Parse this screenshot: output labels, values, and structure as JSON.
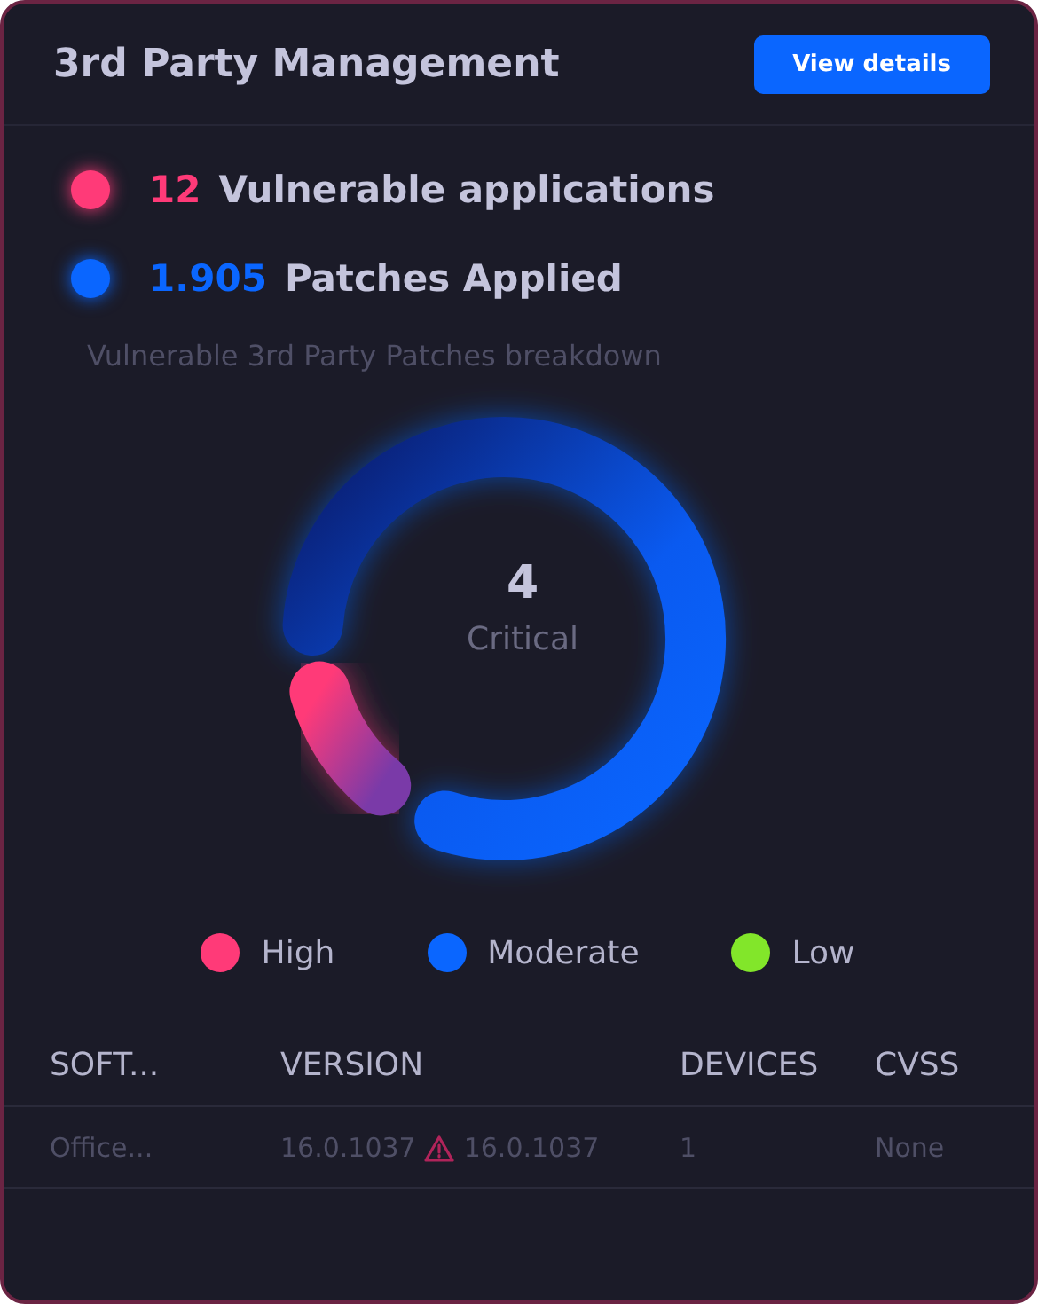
{
  "card": {
    "title": "3rd Party Management",
    "action": "View details"
  },
  "stats": [
    {
      "value": "12",
      "label": "Vulnerable applications",
      "color": "#ff3a78"
    },
    {
      "value": "1.905",
      "label": "Patches Applied",
      "color": "#0a66ff"
    }
  ],
  "breakdown": {
    "title": "Vulnerable 3rd Party Patches breakdown",
    "center_value": "4",
    "center_label": "Critical"
  },
  "legend": [
    {
      "label": "High",
      "color": "#ff3a78"
    },
    {
      "label": "Moderate",
      "color": "#0a66ff"
    },
    {
      "label": "Low",
      "color": "#82e62a"
    }
  ],
  "table": {
    "columns": [
      "SOFT...",
      "VERSION",
      "DEVICES",
      "CVSS"
    ],
    "rows": [
      {
        "software": "Office...",
        "installed": "16.0.1037",
        "warning": true,
        "latest": "16.0.1037",
        "devices": "1",
        "cvss": "None"
      }
    ]
  }
}
